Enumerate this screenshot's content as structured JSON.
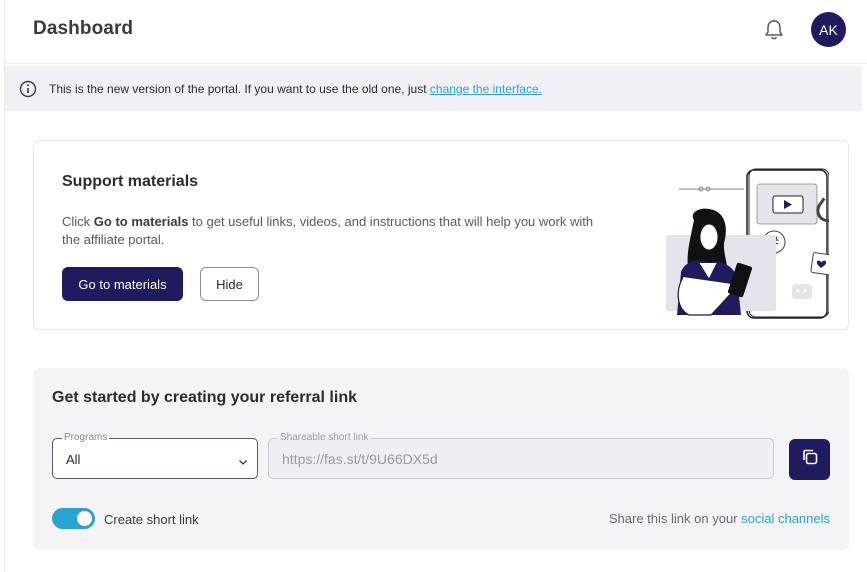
{
  "header": {
    "title": "Dashboard",
    "avatar_initials": "AK"
  },
  "notice": {
    "text": "This is the new version of the portal. If you want to use the old one, just ",
    "link_label": "change the interface."
  },
  "support": {
    "title": "Support materials",
    "desc_prefix": "Click ",
    "desc_bold": "Go to materials",
    "desc_suffix": " to get useful links, videos, and instructions that will help you work with the affiliate portal.",
    "primary_button": "Go to materials",
    "secondary_button": "Hide"
  },
  "referral": {
    "title": "Get started by creating your referral link",
    "programs_label": "Programs",
    "programs_value": "All",
    "link_label": "Shareable short link",
    "link_value": "https://fas.st/t/9U66DX5d",
    "toggle_label": "Create short link",
    "toggle_on": true,
    "share_prefix": "Share this link on your ",
    "share_link": "social channels"
  },
  "colors": {
    "primary": "#1e1b5e",
    "accent": "#2aa3cf",
    "banner_bg": "#f1f1f5",
    "card_bg": "#f4f4f7"
  }
}
